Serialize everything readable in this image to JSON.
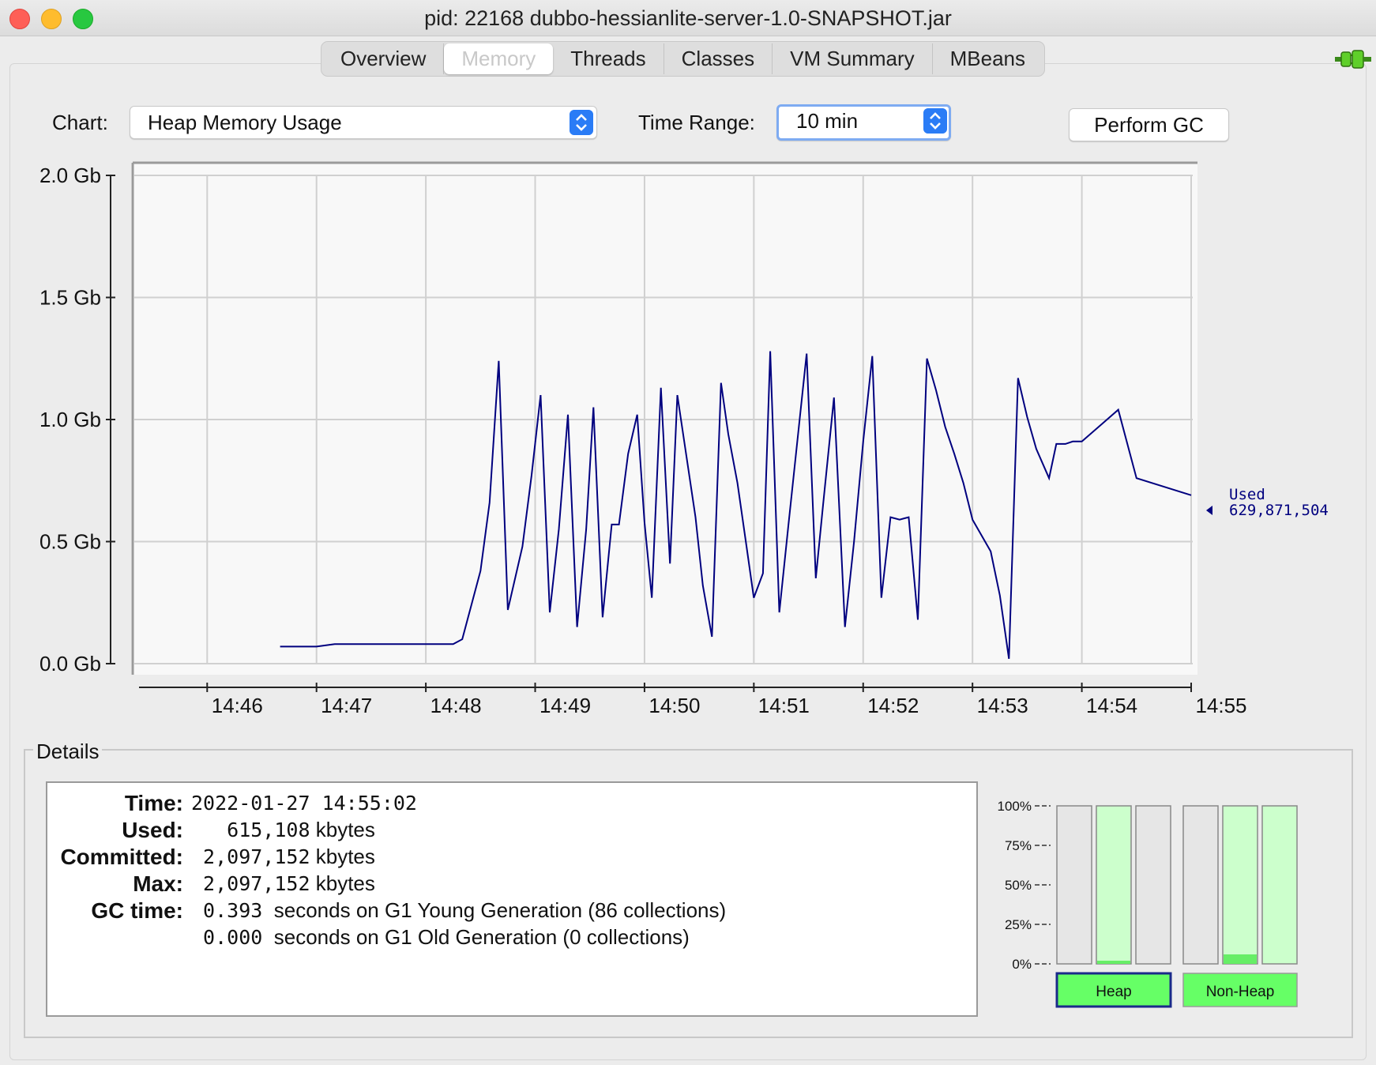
{
  "window": {
    "title": "pid: 22168 dubbo-hessianlite-server-1.0-SNAPSHOT.jar"
  },
  "tabs": [
    {
      "label": "Overview",
      "active": false
    },
    {
      "label": "Memory",
      "active": true
    },
    {
      "label": "Threads",
      "active": false
    },
    {
      "label": "Classes",
      "active": false
    },
    {
      "label": "VM Summary",
      "active": false
    },
    {
      "label": "MBeans",
      "active": false
    }
  ],
  "toolbar": {
    "chart_label": "Chart:",
    "chart_value": "Heap Memory Usage",
    "time_range_label": "Time Range:",
    "time_range_value": "10 min",
    "perform_gc_label": "Perform GC"
  },
  "chart_data": {
    "type": "line",
    "y_ticks": [
      "2.0 Gb",
      "1.5 Gb",
      "1.0 Gb",
      "0.5 Gb",
      "0.0 Gb"
    ],
    "ylim": [
      0,
      2.0
    ],
    "x_ticks": [
      "14:46",
      "14:47",
      "14:48",
      "14:49",
      "14:50",
      "14:51",
      "14:52",
      "14:53",
      "14:54",
      "14:55"
    ],
    "grid": true,
    "series": [
      {
        "name": "Used",
        "color": "#00007f",
        "x": [
          "14:46:40",
          "14:47:00",
          "14:47:10",
          "14:47:20",
          "14:48:05",
          "14:48:15",
          "14:48:20",
          "14:48:30",
          "14:48:35",
          "14:48:40",
          "14:48:45",
          "14:48:53",
          "14:48:58",
          "14:49:03",
          "14:49:08",
          "14:49:13",
          "14:49:18",
          "14:49:23",
          "14:49:28",
          "14:49:32",
          "14:49:37",
          "14:49:42",
          "14:49:46",
          "14:49:51",
          "14:49:56",
          "14:50:00",
          "14:50:04",
          "14:50:09",
          "14:50:14",
          "14:50:18",
          "14:50:23",
          "14:50:28",
          "14:50:32",
          "14:50:37",
          "14:50:42",
          "14:50:46",
          "14:50:51",
          "14:50:56",
          "14:51:00",
          "14:51:05",
          "14:51:09",
          "14:51:14",
          "14:51:19",
          "14:51:24",
          "14:51:29",
          "14:51:34",
          "14:51:38",
          "14:51:44",
          "14:51:50",
          "14:51:55",
          "14:52:00",
          "14:52:05",
          "14:52:10",
          "14:52:15",
          "14:52:20",
          "14:52:25",
          "14:52:30",
          "14:52:35",
          "14:52:40",
          "14:52:45",
          "14:52:50",
          "14:52:55",
          "14:53:00",
          "14:53:10",
          "14:53:15",
          "14:53:20",
          "14:53:25",
          "14:53:30",
          "14:53:35",
          "14:53:42",
          "14:53:46",
          "14:53:51",
          "14:53:55",
          "14:54:00",
          "14:54:20",
          "14:54:30",
          "14:55:00"
        ],
        "y": [
          0.07,
          0.07,
          0.08,
          0.08,
          0.08,
          0.08,
          0.1,
          0.38,
          0.66,
          1.24,
          0.22,
          0.48,
          0.77,
          1.1,
          0.21,
          0.55,
          1.02,
          0.15,
          0.55,
          1.05,
          0.19,
          0.57,
          0.57,
          0.86,
          1.02,
          0.58,
          0.27,
          1.13,
          0.41,
          1.1,
          0.85,
          0.6,
          0.32,
          0.11,
          1.15,
          0.94,
          0.74,
          0.48,
          0.27,
          0.37,
          1.28,
          0.21,
          0.57,
          0.92,
          1.27,
          0.35,
          0.65,
          1.09,
          0.15,
          0.5,
          0.91,
          1.26,
          0.27,
          0.6,
          0.59,
          0.6,
          0.18,
          1.25,
          1.12,
          0.97,
          0.86,
          0.74,
          0.59,
          0.46,
          0.28,
          0.02,
          1.17,
          1.01,
          0.88,
          0.76,
          0.9,
          0.9,
          0.91,
          0.91,
          1.04,
          0.76,
          0.69
        ]
      }
    ]
  },
  "chart_annotation": {
    "label": "Used",
    "value": "629,871,504"
  },
  "details": {
    "legend": "Details",
    "rows": [
      {
        "key": "Time:",
        "value": "2022-01-27 14:55:02",
        "note": ""
      },
      {
        "key": "Used:",
        "value": "   615,108",
        "note": " kbytes"
      },
      {
        "key": "Committed:",
        "value": " 2,097,152",
        "note": " kbytes"
      },
      {
        "key": "Max:",
        "value": " 2,097,152",
        "note": " kbytes"
      },
      {
        "key": "GC time:",
        "value": " 0.393",
        "note": "  seconds on G1 Young Generation (86 collections)"
      },
      {
        "key": "",
        "value": " 0.000",
        "note": "  seconds on G1 Old Generation (0 collections)"
      }
    ]
  },
  "pool_bars": {
    "scale_labels": [
      "100%",
      "75%",
      "50%",
      "25%",
      "0%"
    ],
    "heap": {
      "button_label": "Heap",
      "bars": [
        {
          "committed": 0.0,
          "used": 0.0
        },
        {
          "committed": 1.0,
          "used": 0.02
        },
        {
          "committed": 0.0,
          "used": 0.0
        }
      ]
    },
    "non_heap": {
      "button_label": "Non-Heap",
      "bars": [
        {
          "committed": 0.0,
          "used": 0.0
        },
        {
          "committed": 1.0,
          "used": 0.06
        },
        {
          "committed": 1.0,
          "used": 0.0
        }
      ]
    },
    "colors": {
      "committed": "#ccffcc",
      "used": "#66ee66",
      "empty": "#e6e6e6",
      "selected_border": "#1a2a8a"
    }
  }
}
